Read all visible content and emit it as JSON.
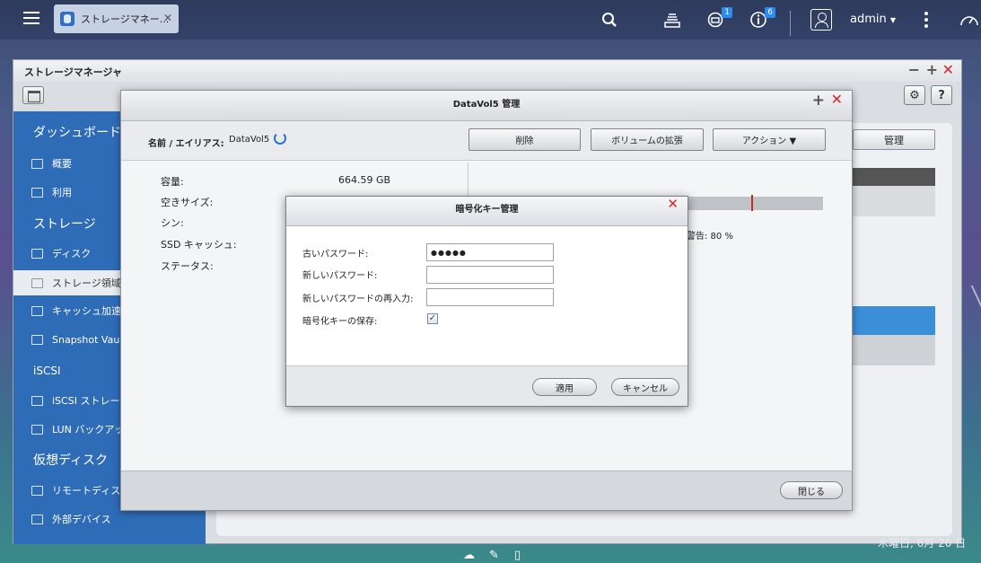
{
  "taskbar": {
    "app_tab_label": "ストレージマネー...",
    "notifications_badge": "1",
    "info_badge": "6",
    "user_name": "admin"
  },
  "main_window": {
    "title": "ストレージマネージャ",
    "sidebar": {
      "dashboard": "ダッシュボード",
      "overview": "概要",
      "utilization": "利用",
      "storage": "ストレージ",
      "disks": "ディスク",
      "storage_space": "ストレージ領域",
      "cache_acceleration": "キャッシュ加速",
      "snapshot_vault": "Snapshot Vault",
      "iscsi": "iSCSI",
      "iscsi_storage": "iSCSI ストレージ",
      "lun_backup": "LUN バックアップ",
      "virtual_disk": "仮想ディスク",
      "remote_disk": "リモートディスク",
      "external_device": "外部デバイス"
    },
    "manage_button": "管理"
  },
  "volume_dialog": {
    "title": "DataVol5 管理",
    "name_label": "名前 / エイリアス:",
    "name_value": "DataVol5",
    "buttons": {
      "delete": "削除",
      "expand": "ボリュームの拡張",
      "action": "アクション ▼"
    },
    "rows": [
      {
        "label": "容量:",
        "value": "664.59 GB"
      },
      {
        "label": "空きサイズ:",
        "value": ""
      },
      {
        "label": "シン:",
        "value": ""
      },
      {
        "label": "SSD キャッシュ:",
        "value": ""
      },
      {
        "label": "ステータス:",
        "value": ""
      }
    ],
    "warning_text": "警告: 80 %",
    "close_button": "閉じる"
  },
  "encryption_dialog": {
    "title": "暗号化キー管理",
    "old_password_label": "古いパスワード:",
    "old_password_value": "●●●●●",
    "new_password_label": "新しいパスワード:",
    "new_password_value": "",
    "confirm_password_label": "新しいパスワードの再入力:",
    "confirm_password_value": "",
    "save_key_label": "暗号化キーの保存:",
    "save_key_checked": true,
    "apply_button": "適用",
    "cancel_button": "キャンセル"
  },
  "desktop": {
    "date_text": "木曜日, 6月 20 日"
  },
  "colors": {
    "sidebar": "#2f6cb8",
    "close_red": "#d6262b",
    "accent_blue": "#3b8ed8"
  }
}
